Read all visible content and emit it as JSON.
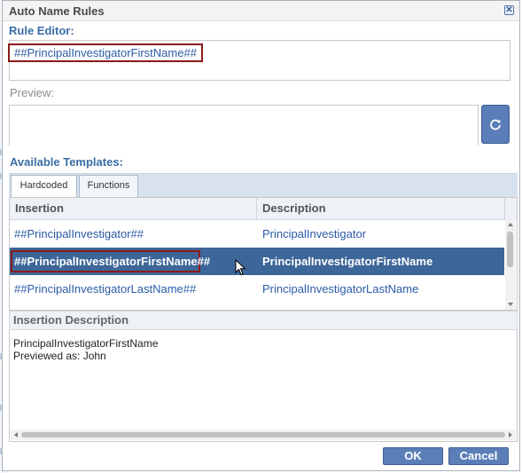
{
  "dialog": {
    "title": "Auto Name Rules",
    "close_icon": "close-icon"
  },
  "rule_editor": {
    "label": "Rule Editor:",
    "value": "##PrincipalInvestigatorFirstName##"
  },
  "preview": {
    "label": "Preview:",
    "value": "",
    "refresh_icon": "refresh-icon"
  },
  "templates": {
    "label": "Available Templates:",
    "tabs": [
      {
        "label": "Hardcoded",
        "active": true
      },
      {
        "label": "Functions",
        "active": false
      }
    ],
    "columns": [
      "Insertion",
      "Description"
    ],
    "rows": [
      {
        "insertion": "##PrincipalInvestigator##",
        "description": "PrincipalInvestigator",
        "selected": false
      },
      {
        "insertion": "##PrincipalInvestigatorFirstName##",
        "description": "PrincipalInvestigatorFirstName",
        "selected": true
      },
      {
        "insertion": "##PrincipalInvestigatorLastName##",
        "description": "PrincipalInvestigatorLastName",
        "selected": false
      }
    ]
  },
  "insertion_description": {
    "header": "Insertion Description",
    "line1": "PrincipalInvestigatorFirstName",
    "line2": "Previewed as: John"
  },
  "buttons": {
    "ok": "OK",
    "cancel": "Cancel"
  },
  "colors": {
    "accent": "#3a6ea5",
    "selected_row": "#3d6699",
    "button": "#5b7eb8",
    "highlight_border": "#8b1a1a"
  }
}
